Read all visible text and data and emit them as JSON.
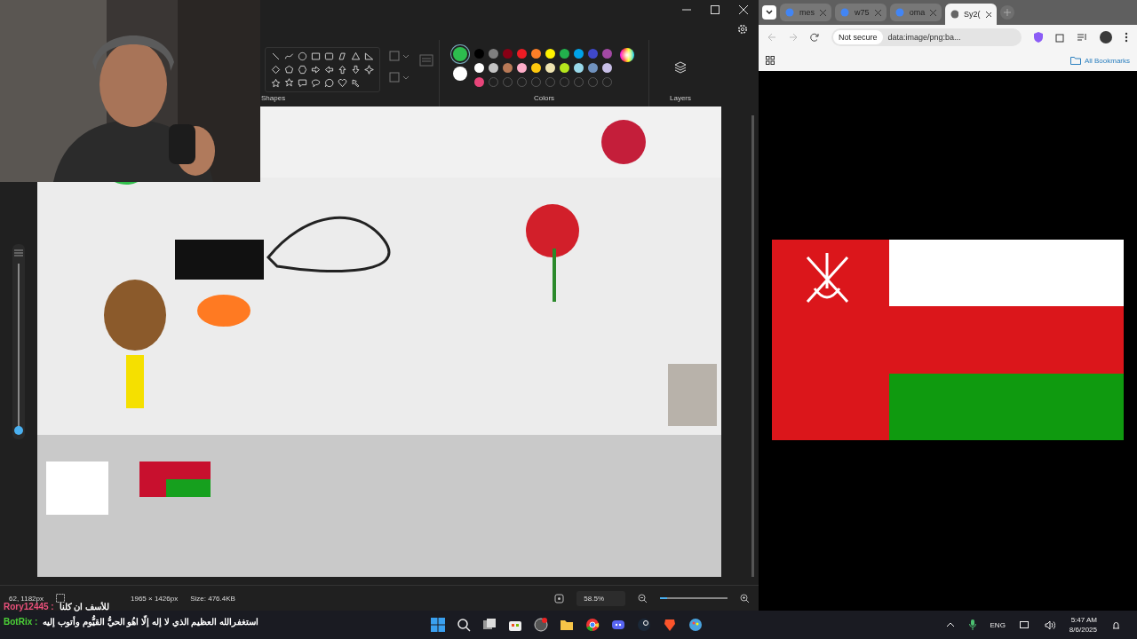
{
  "paint": {
    "ribbon": {
      "shapes_label": "Shapes",
      "colors_label": "Colors",
      "layers_label": "Layers",
      "current_colors": [
        {
          "color": "#2dbd4e",
          "selected": true
        },
        {
          "color": "#ffffff",
          "selected": false
        }
      ],
      "palette": [
        {
          "color": "#000000"
        },
        {
          "color": "#7f7f7f"
        },
        {
          "color": "#880015"
        },
        {
          "color": "#ed1c24"
        },
        {
          "color": "#ff7f27"
        },
        {
          "color": "#fff200"
        },
        {
          "color": "#22b14c"
        },
        {
          "color": "#00a2e8"
        },
        {
          "color": "#3f48cc"
        },
        {
          "color": "#a349a4"
        },
        {
          "color": "#ffffff"
        },
        {
          "color": "#c3c3c3"
        },
        {
          "color": "#b97a57"
        },
        {
          "color": "#ffaec9"
        },
        {
          "color": "#ffc90e"
        },
        {
          "color": "#efe4b0"
        },
        {
          "color": "#b5e61d"
        },
        {
          "color": "#99d9ea"
        },
        {
          "color": "#7092be"
        },
        {
          "color": "#c8bfe7"
        },
        {
          "color": "#e8457a"
        },
        {
          "kind": "empty"
        },
        {
          "kind": "empty"
        },
        {
          "kind": "empty"
        },
        {
          "kind": "empty"
        },
        {
          "kind": "empty"
        },
        {
          "kind": "empty"
        },
        {
          "kind": "empty"
        },
        {
          "kind": "empty"
        },
        {
          "kind": "empty"
        }
      ]
    },
    "layer_slider": {
      "level": 0.0
    },
    "status_bar": {
      "cursor": "62, 1182px",
      "dimensions": "1965 × 1426px",
      "size": "Size: 476.4KB",
      "zoom": "58.5%",
      "zoom_slider": {
        "level": 0.1
      }
    }
  },
  "browser": {
    "tabs": [
      {
        "label": "mes",
        "selected": false
      },
      {
        "label": "w75",
        "selected": false
      },
      {
        "label": "oma",
        "selected": false
      },
      {
        "label": "Sy2(",
        "selected": true
      }
    ],
    "security": "Not secure",
    "address": "data:image/png:ba...",
    "bookmarks": "All Bookmarks"
  },
  "chat": [
    {
      "user": "Rory12445 :",
      "message": "للأسف ان كلنا",
      "color": "#e8507a"
    },
    {
      "user": "BotRix :",
      "message": "استغفرالله العظيم الذي لا إله إلّا اهُو الحيُّ القيُّوم وأتوب إليه",
      "color": "#4cd137"
    }
  ],
  "taskbar": {
    "language": "ENG",
    "time": "5:47 AM",
    "date": "8/6/2025"
  }
}
